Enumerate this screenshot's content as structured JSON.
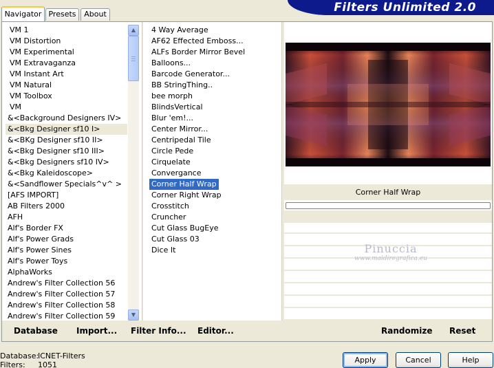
{
  "tabs": [
    {
      "label": "Navigator",
      "active": true
    },
    {
      "label": "Presets",
      "active": false
    },
    {
      "label": "About",
      "active": false
    }
  ],
  "header": {
    "title": "Filters Unlimited 2.0"
  },
  "categories": [
    {
      "label": "VM 1"
    },
    {
      "label": "VM Distortion"
    },
    {
      "label": "VM Experimental"
    },
    {
      "label": "VM Extravaganza"
    },
    {
      "label": "VM Instant Art"
    },
    {
      "label": "VM Natural"
    },
    {
      "label": "VM Toolbox"
    },
    {
      "label": "VM"
    },
    {
      "label": "&<Background Designers IV>"
    },
    {
      "label": "&<Bkg Designer sf10 I>",
      "selected": true
    },
    {
      "label": "&<BKg Designer sf10 II>"
    },
    {
      "label": "&<Bkg Designer sf10 III>"
    },
    {
      "label": "&<Bkg Designers sf10 IV>"
    },
    {
      "label": "&<Bkg Kaleidoscope>"
    },
    {
      "label": "&<Sandflower Specials^v^ >"
    },
    {
      "label": "[AFS IMPORT]"
    },
    {
      "label": "AB Filters 2000"
    },
    {
      "label": "AFH"
    },
    {
      "label": "Alf's Border FX"
    },
    {
      "label": "Alf's Power Grads"
    },
    {
      "label": "Alf's Power Sines"
    },
    {
      "label": "Alf's Power Toys"
    },
    {
      "label": "AlphaWorks"
    },
    {
      "label": "Andrew's Filter Collection 56"
    },
    {
      "label": "Andrew's Filter Collection 57"
    },
    {
      "label": "Andrew's Filter Collection 58"
    },
    {
      "label": "Andrew's Filter Collection 59"
    }
  ],
  "filters": [
    {
      "label": "4 Way Average"
    },
    {
      "label": "AF62 Effected Emboss..."
    },
    {
      "label": "ALFs Border Mirror Bevel"
    },
    {
      "label": "Balloons..."
    },
    {
      "label": "Barcode Generator..."
    },
    {
      "label": "BB StringThing.."
    },
    {
      "label": "bee morph"
    },
    {
      "label": "BlindsVertical"
    },
    {
      "label": "Blur 'em!..."
    },
    {
      "label": "Center Mirror..."
    },
    {
      "label": "Centripedal Tile"
    },
    {
      "label": "Circle Pede"
    },
    {
      "label": "Cirquelate"
    },
    {
      "label": "Convergance"
    },
    {
      "label": "Corner Half Wrap",
      "selected": true
    },
    {
      "label": "Corner Right Wrap"
    },
    {
      "label": "Crosstitch"
    },
    {
      "label": "Cruncher"
    },
    {
      "label": "Cut Glass  BugEye"
    },
    {
      "label": "Cut Glass 03"
    },
    {
      "label": "Dice It"
    }
  ],
  "preview": {
    "filter_name": "Corner Half Wrap"
  },
  "watermark": {
    "name": "Pinuccia",
    "url": "www.maidiregrafica.eu"
  },
  "toolbar": {
    "database": "Database",
    "import": "Import...",
    "filter_info": "Filter Info...",
    "editor": "Editor...",
    "randomize": "Randomize",
    "reset": "Reset"
  },
  "status": {
    "database_label": "Database:",
    "database_value": "ICNET-Filters",
    "filters_label": "Filters:",
    "filters_value": "1051"
  },
  "dialog": {
    "apply": "Apply",
    "cancel": "Cancel",
    "help": "Help"
  },
  "colors": {
    "selection": "#316ac5",
    "banner": "#0d1a8c",
    "tab_highlight": "#ffc83c"
  }
}
